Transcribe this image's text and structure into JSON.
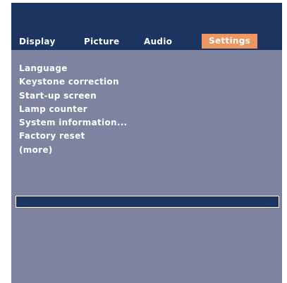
{
  "tabs": [
    {
      "label": "Display",
      "active": false
    },
    {
      "label": "Picture",
      "active": false
    },
    {
      "label": "Audio",
      "active": false
    },
    {
      "label": "Settings",
      "active": true
    }
  ],
  "menu": {
    "items": [
      "Language",
      "Keystone correction",
      "Start-up screen",
      "Lamp counter",
      "System information...",
      "Factory reset",
      "(more)"
    ]
  },
  "colors": {
    "header_background": "#1d3461",
    "panel_background": "#7e84a0",
    "active_tab": "#f0955f",
    "text": "#ffffff"
  }
}
